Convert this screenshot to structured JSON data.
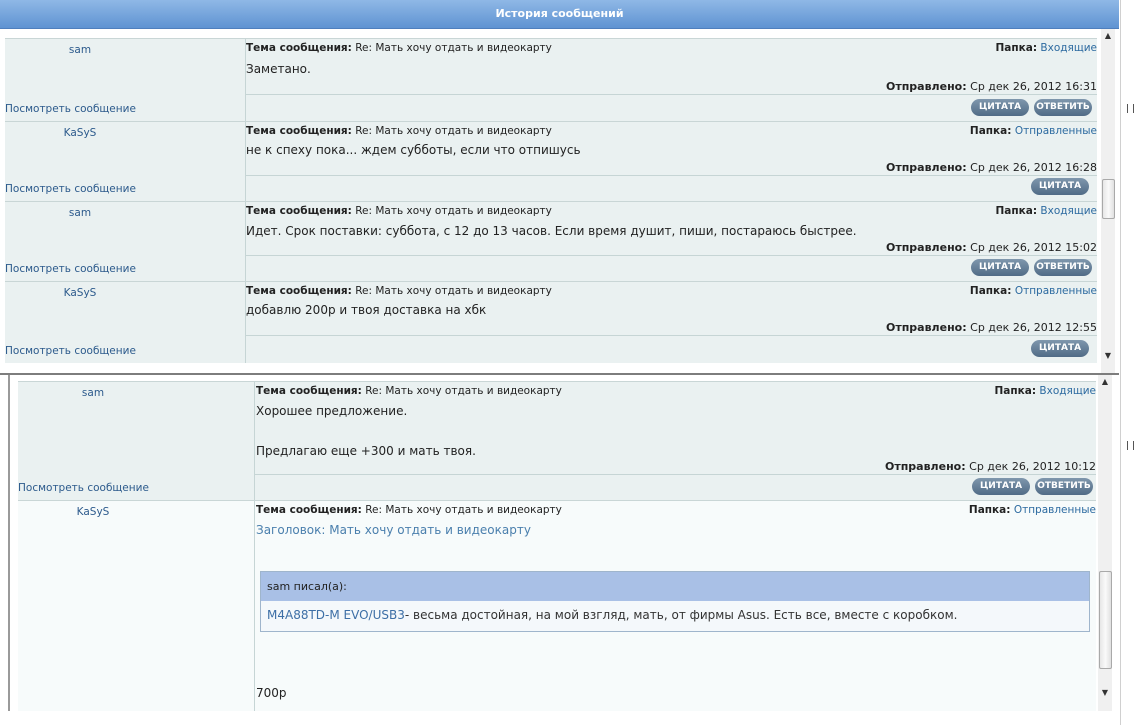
{
  "window_title": "История сообщений",
  "labels": {
    "subject": "Тема сообщения:",
    "folder": "Папка:",
    "sent": "Отправлено:",
    "view": "Посмотреть сообщение",
    "quote_btn": "ЦИТАТА",
    "reply_btn": "ОТВЕТИТЬ"
  },
  "top_messages": [
    {
      "author": "sam",
      "subject": "Re: Мать хочу отдать и видеокарту",
      "folder": "Входящие",
      "body": "Заметано.",
      "sent": "Ср дек 26, 2012 16:31"
    },
    {
      "author": "KaSyS",
      "subject": "Re: Мать хочу отдать и видеокарту",
      "folder": "Отправленные",
      "body": "не к спеху пока... ждем субботы, если что отпишусь",
      "sent": "Ср дек 26, 2012 16:28"
    },
    {
      "author": "sam",
      "subject": "Re: Мать хочу отдать и видеокарту",
      "folder": "Входящие",
      "body": "Идет. Срок поставки: суббота, с 12 до 13 часов. Если время душит, пиши, постараюсь быстрее.",
      "sent": "Ср дек 26, 2012 15:02"
    },
    {
      "author": "KaSyS",
      "subject": "Re: Мать хочу отдать и видеокарту",
      "folder": "Отправленные",
      "body": "добавлю 200р и твоя доставка на хбк",
      "sent": "Ср дек 26, 2012 12:55"
    }
  ],
  "bottom_messages": [
    {
      "author": "sam",
      "subject": "Re: Мать хочу отдать и видеокарту",
      "folder": "Входящие",
      "body_line1": "Хорошее предложение.",
      "body_line2": "Предлагаю еще +300 и мать твоя.",
      "sent": "Ср дек 26, 2012 10:12"
    },
    {
      "author": "KaSyS",
      "subject": "Re: Мать хочу отдать и видеокарту",
      "folder": "Отправленные",
      "heading": "Заголовок: Мать хочу отдать и видеокарту",
      "quote_author": "sam писал(а):",
      "quote_link": "M4A88TD-M EVO/USB3",
      "quote_text": "- весьма достойная, на мой взгляд, мать, от фирмы Asus. Есть все, вместе с коробком.",
      "tail": "700р"
    }
  ]
}
